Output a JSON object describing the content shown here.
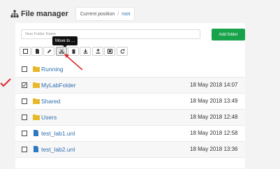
{
  "header": {
    "title": "File manager",
    "current_position_label": "Current position",
    "separator": "/",
    "root_label": "root"
  },
  "form": {
    "new_folder_placeholder": "New Folder Name",
    "add_folder_label": "Add folder"
  },
  "toolbar": {
    "tooltip": "Move to ...",
    "buttons": [
      {
        "icon": "checkbox-icon"
      },
      {
        "icon": "new-file-icon"
      },
      {
        "icon": "pencil-icon"
      },
      {
        "icon": "scissors-icon"
      },
      {
        "icon": "trash-icon"
      },
      {
        "icon": "download-icon"
      },
      {
        "icon": "upload-icon"
      },
      {
        "icon": "export-icon"
      },
      {
        "icon": "refresh-icon"
      }
    ]
  },
  "files": [
    {
      "name": "Running",
      "type": "folder",
      "date": "",
      "checked": false
    },
    {
      "name": "MyLabFolder",
      "type": "folder",
      "date": "18 May 2018 14:07",
      "checked": true
    },
    {
      "name": "Shared",
      "type": "folder",
      "date": "18 May 2018 13:49",
      "checked": false
    },
    {
      "name": "Users",
      "type": "folder",
      "date": "18 May 2018 12:48",
      "checked": false
    },
    {
      "name": "test_lab1.unl",
      "type": "file",
      "date": "18 May 2018 12:58",
      "checked": false
    },
    {
      "name": "test_lab2.unl",
      "type": "file",
      "date": "18 May 2018 13:36",
      "checked": false
    }
  ],
  "colors": {
    "accent_green": "#18a24a",
    "folder": "#e8b82a",
    "file": "#2f78c4",
    "link": "#2f6fb0",
    "annotation_red": "#d9262b"
  }
}
